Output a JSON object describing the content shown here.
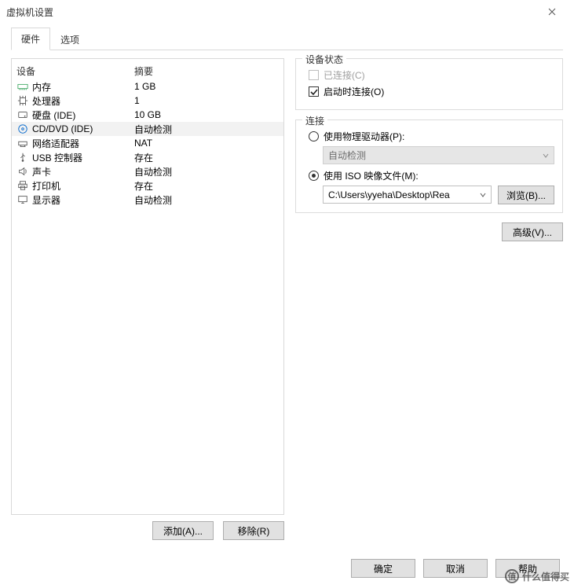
{
  "title": "虚拟机设置",
  "tabs": {
    "hardware": "硬件",
    "options": "选项"
  },
  "hw": {
    "header_device": "设备",
    "header_summary": "摘要",
    "rows": [
      {
        "icon": "memory-icon",
        "name": "内存",
        "summary": "1 GB"
      },
      {
        "icon": "cpu-icon",
        "name": "处理器",
        "summary": "1"
      },
      {
        "icon": "disk-icon",
        "name": "硬盘 (IDE)",
        "summary": "10 GB"
      },
      {
        "icon": "cd-icon",
        "name": "CD/DVD (IDE)",
        "summary": "自动检测"
      },
      {
        "icon": "network-icon",
        "name": "网络适配器",
        "summary": "NAT"
      },
      {
        "icon": "usb-icon",
        "name": "USB 控制器",
        "summary": "存在"
      },
      {
        "icon": "sound-icon",
        "name": "声卡",
        "summary": "自动检测"
      },
      {
        "icon": "printer-icon",
        "name": "打印机",
        "summary": "存在"
      },
      {
        "icon": "display-icon",
        "name": "显示器",
        "summary": "自动检测"
      }
    ],
    "selected_index": 3,
    "add_btn": "添加(A)...",
    "remove_btn": "移除(R)"
  },
  "status_group": {
    "title": "设备状态",
    "connected": "已连接(C)",
    "connect_at_power": "启动时连接(O)"
  },
  "conn_group": {
    "title": "连接",
    "use_physical": "使用物理驱动器(P):",
    "physical_value": "自动检测",
    "use_iso": "使用 ISO 映像文件(M):",
    "iso_path": "C:\\Users\\yyeha\\Desktop\\Rea",
    "browse": "浏览(B)..."
  },
  "advanced_btn": "高级(V)...",
  "bottom": {
    "ok": "确定",
    "cancel": "取消",
    "help": "帮助"
  },
  "watermark": "什么值得买"
}
